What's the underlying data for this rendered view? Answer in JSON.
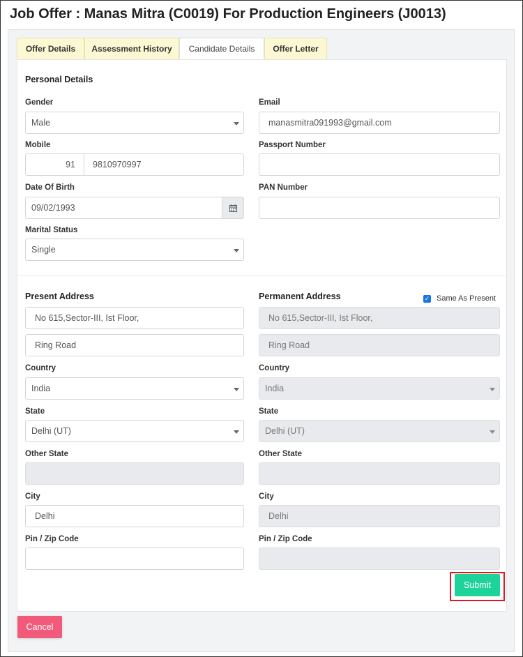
{
  "page": {
    "title": "Job Offer :  Manas Mitra (C0019) For Production Engineers (J0013)"
  },
  "tabs": [
    {
      "label": "Offer Details",
      "active": false
    },
    {
      "label": "Assessment History",
      "active": false
    },
    {
      "label": "Candidate Details",
      "active": true
    },
    {
      "label": "Offer Letter",
      "active": false
    }
  ],
  "personal": {
    "title": "Personal Details",
    "gender": {
      "label": "Gender",
      "value": "Male"
    },
    "email": {
      "label": "Email",
      "value": "manasmitra091993@gmail.com"
    },
    "mobile": {
      "label": "Mobile",
      "code": "91",
      "number": "9810970997"
    },
    "passport": {
      "label": "Passport Number",
      "value": ""
    },
    "dob": {
      "label": "Date Of Birth",
      "value": "09/02/1993"
    },
    "pan": {
      "label": "PAN Number",
      "value": ""
    },
    "marital": {
      "label": "Marital Status",
      "value": "Single"
    }
  },
  "present": {
    "title": "Present Address",
    "line1": "No 615,Sector-III, Ist Floor,",
    "line2": "Ring Road",
    "country_label": "Country",
    "country": "India",
    "state_label": "State",
    "state": "Delhi (UT)",
    "other_state_label": "Other State",
    "other_state": "",
    "city_label": "City",
    "city": "Delhi",
    "pin_label": "Pin / Zip Code",
    "pin": ""
  },
  "permanent": {
    "title": "Permanent Address",
    "same_as_present_label": "Same As Present",
    "same_as_present": true,
    "line1": "No 615,Sector-III, Ist Floor,",
    "line2": "Ring Road",
    "country_label": "Country",
    "country": "India",
    "state_label": "State",
    "state": "Delhi (UT)",
    "other_state_label": "Other State",
    "other_state": "",
    "city_label": "City",
    "city": "Delhi",
    "pin_label": "Pin / Zip Code",
    "pin": ""
  },
  "actions": {
    "submit": "Submit",
    "cancel": "Cancel"
  },
  "colors": {
    "tab_inactive_bg": "#fbf8d3",
    "submit_bg": "#1ed39a",
    "cancel_bg": "#f15a7a",
    "highlight_outline": "#e0191e",
    "checkbox": "#1a73e8"
  }
}
